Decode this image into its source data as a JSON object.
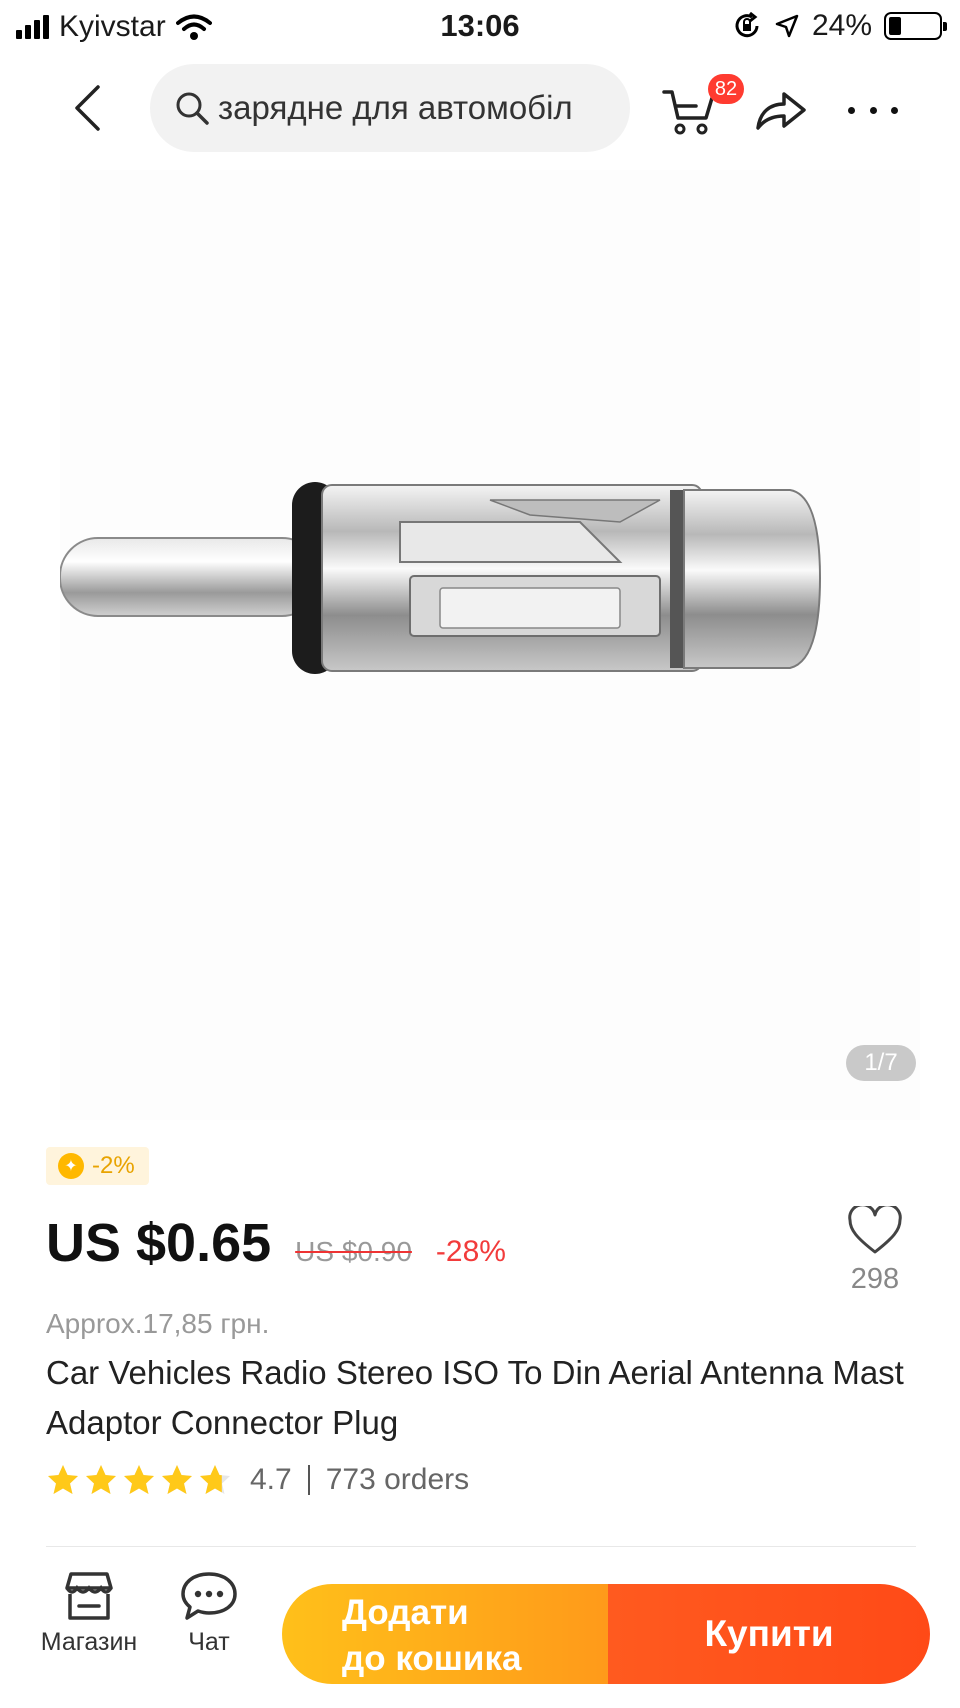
{
  "status_bar": {
    "carrier": "Kyivstar",
    "time": "13:06",
    "battery": "24%",
    "battery_level": 0.24
  },
  "header": {
    "search_text": "зарядне для автомобіл",
    "cart_count": "82"
  },
  "gallery": {
    "page_indicator": "1/7"
  },
  "product": {
    "coins_discount": "-2%",
    "price": "US $0.65",
    "old_price": "US $0.90",
    "discount": "-28%",
    "approx_price": "Approx.17,85 грн.",
    "title": "Car Vehicles Radio Stereo ISO To Din Aerial Antenna Mast Adaptor Connector Plug",
    "rating": "4.7",
    "rating_value": 4.7,
    "orders": "773 orders",
    "wishlist_count": "298"
  },
  "bottom_bar": {
    "store_label": "Магазин",
    "chat_label": "Чат",
    "add_to_cart_line1": "Додати",
    "add_to_cart_line2": "до кошика",
    "buy_label": "Купити"
  },
  "colors": {
    "accent": "#ff4a17",
    "add_to_cart": "#ffb21a",
    "discount": "#f23b3b",
    "star": "#ffc919",
    "badge": "#ff3b30"
  }
}
